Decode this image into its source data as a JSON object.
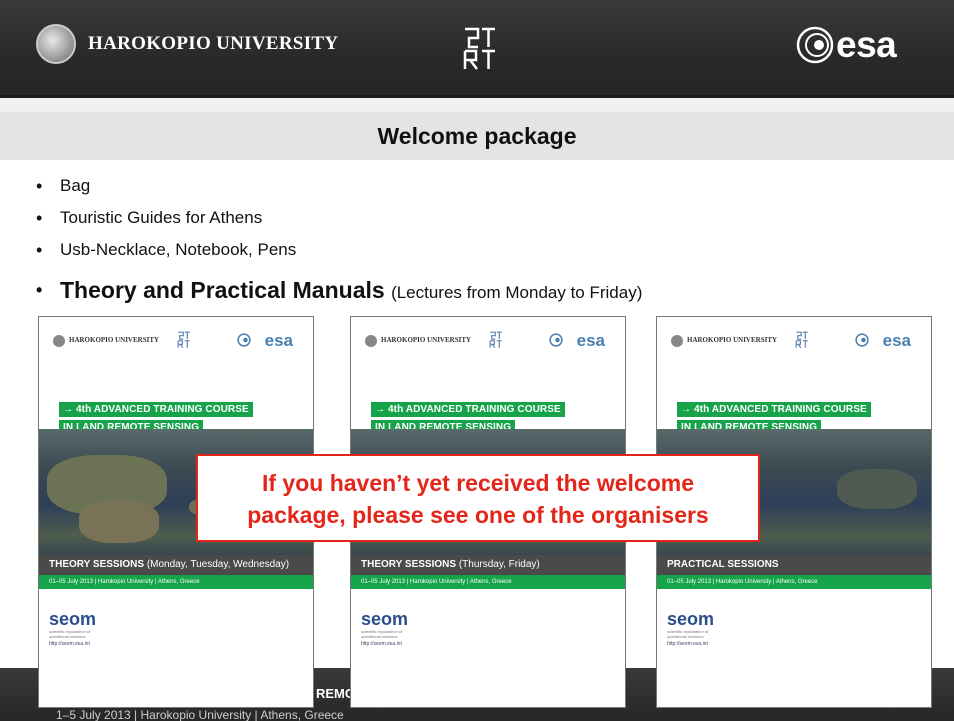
{
  "header": {
    "university": "HAROKOPIO UNIVERSITY",
    "agency": "esa"
  },
  "slide": {
    "title": "Welcome package",
    "bullets": [
      {
        "text": "Bag"
      },
      {
        "text": "Touristic Guides for Athens"
      },
      {
        "text": "Usb-Necklace, Notebook, Pens"
      },
      {
        "text": "Theory and Practical Manuals",
        "note": "(Lectures from Monday to Friday)"
      }
    ],
    "callout": {
      "line1": "If you haven’t yet received the welcome",
      "line2": "package, please see one of the organisers"
    }
  },
  "covers": [
    {
      "university": "HAROKOPIO UNIVERSITY",
      "agency": "esa",
      "course_line1": "→ 4th ADVANCED TRAINING COURSE",
      "course_line2": "IN LAND REMOTE SENSING",
      "session": "THEORY SESSIONS",
      "session_sub": "(Monday, Tuesday, Wednesday)",
      "date": "01–05 July 2013 | Harokopio University | Athens, Greece",
      "seom": "seom",
      "seom_sub": "scientific exploitation of operational missions",
      "url": "http://seom.esa.int"
    },
    {
      "university": "HAROKOPIO UNIVERSITY",
      "agency": "esa",
      "course_line1": "→ 4th ADVANCED TRAINING COURSE",
      "course_line2": "IN LAND REMOTE SENSING",
      "session": "THEORY SESSIONS",
      "session_sub": "(Thursday, Friday)",
      "date": "01–05 July 2013 | Harokopio University | Athens, Greece",
      "seom": "seom",
      "seom_sub": "scientific exploitation of operational missions",
      "url": "http://seom.esa.int"
    },
    {
      "university": "HAROKOPIO UNIVERSITY",
      "agency": "esa",
      "course_line1": "→ 4th ADVANCED TRAINING COURSE",
      "course_line2": "IN LAND REMOTE SENSING",
      "session": "PRACTICAL SESSIONS",
      "session_sub": "",
      "date": "01–05 July 2013 | Harokopio University | Athens, Greece",
      "seom": "seom",
      "seom_sub": "scientific exploitation of operational missions",
      "url": "http://seom.esa.int"
    }
  ],
  "footer": {
    "partial_title": "REMC",
    "date_line": "1–5 July 2013 | Harokopio University | Athens, Greece"
  },
  "colors": {
    "band": "#2a2a2a",
    "title_bar": "#e4e4e4",
    "accent_green": "#16a34a",
    "callout_red": "#e32619",
    "esa_blue": "#4a7fb0"
  }
}
